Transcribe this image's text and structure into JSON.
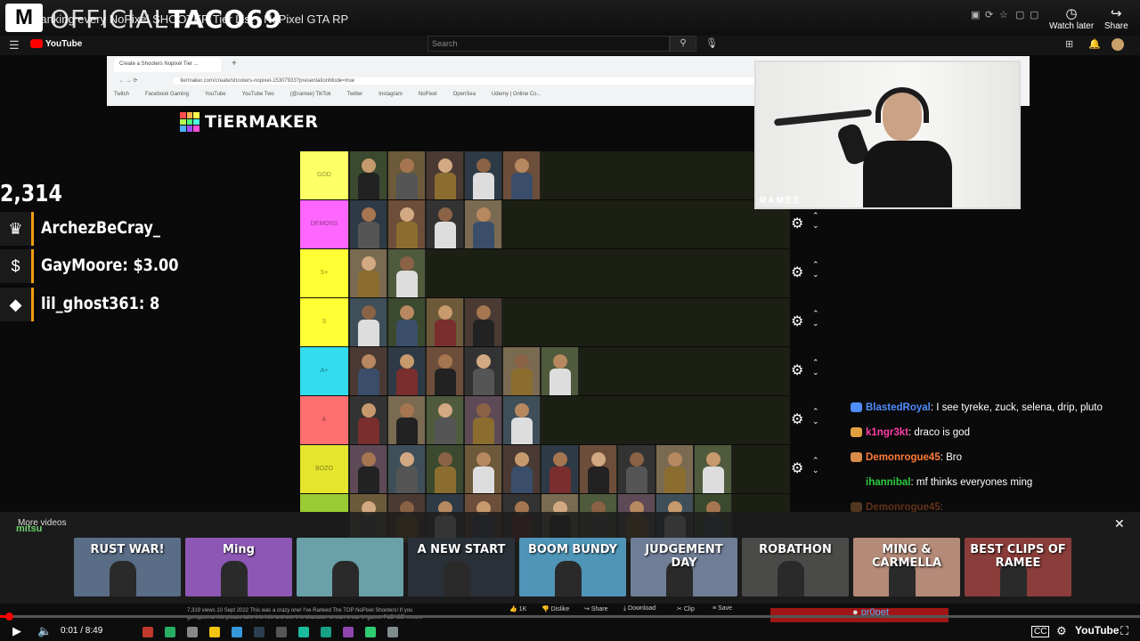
{
  "top": {
    "video_title": "Ranking every NoPixel SHOOTER Tier List - NoPixel GTA RP",
    "brand_m": "M",
    "brand_official": "OFFICIAL",
    "brand_taco": "TACO69",
    "watch_later": "Watch later",
    "share": "Share"
  },
  "yt": {
    "logo": "YouTube",
    "search_placeholder": "Search"
  },
  "browser": {
    "tab_title": "Create a Shooters Nopixel Tier ...",
    "new_tab": "+",
    "url": "tiermaker.com/create/shooters-nopixel-15307933?presentationMode=true",
    "bookmarks": [
      "Twitch",
      "Facebook Gaming",
      "YouTube",
      "YouTube Two",
      "(@ramee) TikTok",
      "Twitter",
      "Instagram",
      "NoPixel",
      "OpenSea",
      "Udemy | Online Co..."
    ]
  },
  "tiermaker": {
    "logo": "TiERMAKER"
  },
  "tiers": [
    {
      "label": "GOD",
      "color": "#ffff66",
      "count": 5
    },
    {
      "label": "DEMONS",
      "color": "#ff66ff",
      "count": 4
    },
    {
      "label": "S+",
      "color": "#ffff33",
      "count": 2
    },
    {
      "label": "S",
      "color": "#ffff33",
      "count": 4
    },
    {
      "label": "A+",
      "color": "#33ddee",
      "count": 6
    },
    {
      "label": "A",
      "color": "#ff6f6f",
      "count": 5
    },
    {
      "label": "BOZO",
      "color": "#e5e52e",
      "count": 10
    },
    {
      "label": "",
      "color": "#99cc33",
      "count": 10
    }
  ],
  "overlay": {
    "counter": "2,314",
    "top_gifter": "ArchezBeCray_",
    "top_donation": "GayMoore: $3.00",
    "top_bits": "lil_ghost361: 8",
    "cam_tag": "RAMEE"
  },
  "chat": [
    {
      "user": "BlastedRoyal",
      "msg": "I see tyreke, zuck, selena, drip, pluto",
      "color": "#4f8cff"
    },
    {
      "user": "k1ngr3kt",
      "msg": "draco is god",
      "color": "#ff3ea5"
    },
    {
      "user": "Demonrogue45",
      "msg": "Bro",
      "color": "#ff7a3a"
    },
    {
      "user": "ihannibal",
      "msg": "mf thinks everyones ming",
      "color": "#2ecc40"
    },
    {
      "user": "Demonrogue45",
      "msg": "",
      "color": "#ff7a3a"
    }
  ],
  "more_videos": {
    "title": "More videos",
    "mitsu": "mitsu",
    "thumbs": [
      {
        "text": "RUST WAR!",
        "bg": "#5a6d86"
      },
      {
        "text": "Ming",
        "bg": "#8d57b5"
      },
      {
        "text": "",
        "bg": "#6aa0a8"
      },
      {
        "text": "A NEW START",
        "bg": "#2a3038"
      },
      {
        "text": "BOOM BUNDY",
        "bg": "#4f95b8"
      },
      {
        "text": "JUDGEMENT DAY",
        "bg": "#6f7d96"
      },
      {
        "text": "ROBATHON",
        "bg": "#4a4a48"
      },
      {
        "text": "MING & CARMELLA",
        "bg": "#b48a78"
      },
      {
        "text": "BEST CLIPS OF RAMEE",
        "bg": "#8a3d3a"
      }
    ]
  },
  "bottom": {
    "time": "0:01 / 8:49",
    "youtube": "YouTube",
    "desc_line1": "7,319 views  10 Sept 2022  This was a crazy one! I've Ranked The TOP NoPixel Shooters! If you",
    "desc_line2": "get upset at this please take this info and use it in character to start a war in game. PLEASE ...more",
    "like": "1K",
    "dislike": "Dislike",
    "share": "Share",
    "download": "Download",
    "clip": "Clip",
    "save": "Save",
    "chat_last_user": "pr0pet"
  },
  "colors": {
    "accent": "#f39c12",
    "progress": "#ff0000"
  }
}
